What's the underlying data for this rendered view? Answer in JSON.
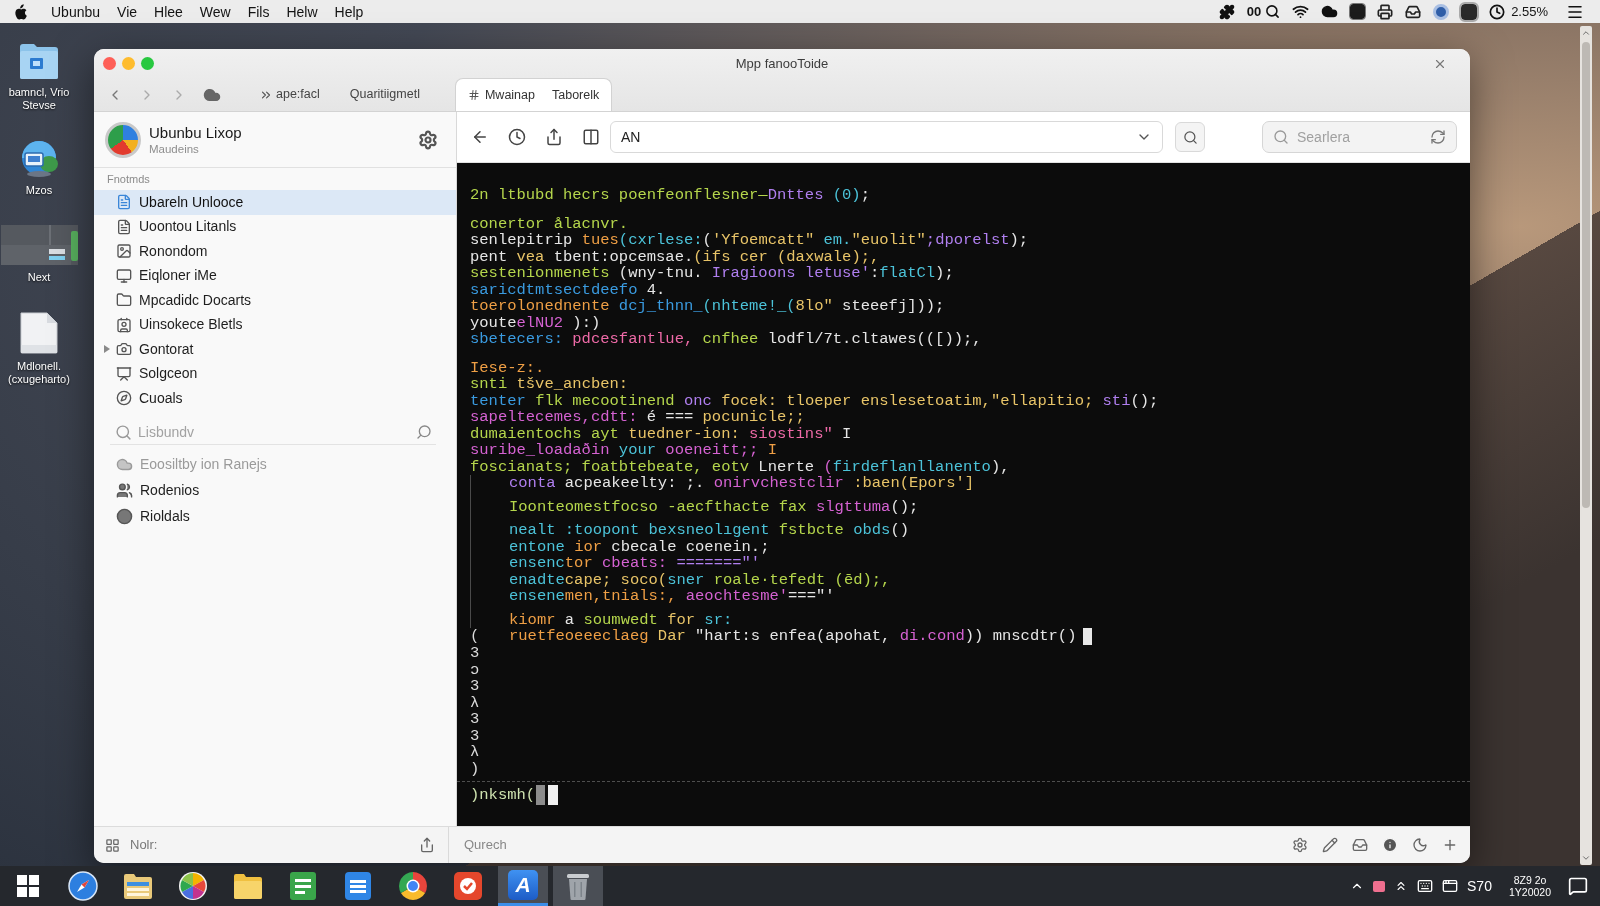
{
  "menu_bar": {
    "items": [
      "Ubunbu",
      "Vie",
      "Hlee",
      "Wew",
      "Fils",
      "Helw",
      "Help"
    ],
    "status_text": "00",
    "battery_text": "2.55%"
  },
  "desktop_icons": [
    {
      "label": "bamncl, Vrio Stevse"
    },
    {
      "label": "Mzos"
    },
    {
      "label": "Next"
    },
    {
      "label": "Mdlonell. (cxugeharto)"
    }
  ],
  "window": {
    "title": "Mpp fanooToide"
  },
  "tabs": [
    {
      "label": "ape:facl",
      "selected": false
    },
    {
      "label": "Quaritiigmetl",
      "selected": false
    },
    {
      "label": "Mwainap",
      "note": "Taborelk",
      "selected": true
    }
  ],
  "sidebar": {
    "profile": {
      "name": "Ubunbu Lixop",
      "subtitle": "Maudeins"
    },
    "section_label": "Fnotmds",
    "items": [
      {
        "label": "Ubareln Unlooce",
        "selected": true
      },
      {
        "label": "Uoontou Litanls",
        "selected": false
      },
      {
        "label": "Ronondom",
        "selected": false
      },
      {
        "label": "Eiqloner iMe",
        "selected": false
      },
      {
        "label": "Mpcadidc Docarts",
        "selected": false
      },
      {
        "label": "Uinsokece Bletls",
        "selected": false
      },
      {
        "label": "Gontorat",
        "selected": false,
        "expanded": false
      },
      {
        "label": "Solgceon",
        "selected": false
      },
      {
        "label": "Cuoals",
        "selected": false
      }
    ],
    "search": {
      "placeholder": "Lisbundv"
    },
    "extra_items": [
      {
        "label": "Eoosiltby ion Ranejs",
        "disabled": true
      },
      {
        "label": "Rodenios",
        "disabled": false
      },
      {
        "label": "Rioldals",
        "disabled": false
      }
    ]
  },
  "toolbar": {
    "address": "AN",
    "search": {
      "placeholder": "Searlera"
    }
  },
  "terminal": {
    "blocks": [
      {
        "lines": [
          {
            "cursor": false,
            "segments": [
              {
                "text": "2n ltbubd hecrs poenfeonflesner—",
                "color": "#b5d64c"
              },
              {
                "text": "Dnttes",
                "color": "#b07ff0"
              },
              {
                "text": " (0)",
                "color": "#4cc3d9"
              },
              {
                "text": ";",
                "color": "#e6e6e6"
              }
            ]
          }
        ]
      },
      {
        "lines": [
          {
            "cursor": false,
            "segments": [
              {
                "text": "conertor ålacnvr.",
                "color": "#b5d64c"
              }
            ]
          },
          {
            "cursor": false,
            "segments": [
              {
                "text": "senlepitrip ",
                "color": "#e6e6e6"
              },
              {
                "text": "tues",
                "color": "#ef9f45"
              },
              {
                "text": "(cxrlese:",
                "color": "#4cc3d9"
              },
              {
                "text": "(",
                "color": "#e6e6e6"
              },
              {
                "text": "'Yfoemcatt\"",
                "color": "#e8c468"
              },
              {
                "text": " em.",
                "color": "#4cc3d9"
              },
              {
                "text": "\"euolit\"",
                "color": "#e8c468"
              },
              {
                "text": ";dporelst",
                "color": "#b07ff0"
              },
              {
                "text": ");",
                "color": "#e6e6e6"
              }
            ]
          },
          {
            "cursor": false,
            "segments": [
              {
                "text": "pent ",
                "color": "#e6e6e6"
              },
              {
                "text": "vea ",
                "color": "#e8c468"
              },
              {
                "text": "tbent:opcemsae.",
                "color": "#e6e6e6"
              },
              {
                "text": "(ifs cer (daxwale);,",
                "color": "#e8c468"
              }
            ]
          },
          {
            "cursor": false,
            "segments": [
              {
                "text": "sestenionmenets ",
                "color": "#b5d64c"
              },
              {
                "text": "(wny-tnu. ",
                "color": "#e6e6e6"
              },
              {
                "text": "Iragioons letuse'",
                "color": "#b07ff0"
              },
              {
                "text": ":",
                "color": "#e6e6e6"
              },
              {
                "text": "flatCl",
                "color": "#4cc3d9"
              },
              {
                "text": ");",
                "color": "#e6e6e6"
              }
            ]
          },
          {
            "cursor": false,
            "segments": [
              {
                "text": "saricdtmtsectdeefo",
                "color": "#3a9be0"
              },
              {
                "text": " 4.",
                "color": "#e6e6e6"
              }
            ]
          },
          {
            "cursor": false,
            "segments": [
              {
                "text": "toerolonednente ",
                "color": "#ef9f45"
              },
              {
                "text": "dcj_thnn_",
                "color": "#3a9be0"
              },
              {
                "text": "(nhteme!_(",
                "color": "#4cc3d9"
              },
              {
                "text": "8lo\"",
                "color": "#e8c468"
              },
              {
                "text": " steeefj]));",
                "color": "#e6e6e6"
              }
            ]
          },
          {
            "cursor": false,
            "segments": [
              {
                "text": "youte",
                "color": "#e6e6e6"
              },
              {
                "text": "elNU2",
                "color": "#d562d2"
              },
              {
                "text": " ):)",
                "color": "#e6e6e6"
              }
            ]
          },
          {
            "cursor": false,
            "segments": [
              {
                "text": "sbetecers:",
                "color": "#3a9be0"
              },
              {
                "text": " pdcesfantlue,",
                "color": "#ee6aa7"
              },
              {
                "text": " cnfhee",
                "color": "#b5d64c"
              },
              {
                "text": " lodfl/7t.cltawes(([));,",
                "color": "#e6e6e6"
              }
            ]
          }
        ]
      },
      {
        "lines": [
          {
            "cursor": false,
            "segments": [
              {
                "text": "Iese-z:.",
                "color": "#ef9f45"
              }
            ]
          },
          {
            "cursor": false,
            "segments": [
              {
                "text": "snti ",
                "color": "#b5d64c"
              },
              {
                "text": "tšve_ancben:",
                "color": "#e8c468"
              }
            ]
          },
          {
            "cursor": false,
            "segments": [
              {
                "text": "tenter ",
                "color": "#3a9be0"
              },
              {
                "text": "flk mecootinend ",
                "color": "#b5d64c"
              },
              {
                "text": "onc ",
                "color": "#b07ff0"
              },
              {
                "text": "focek: tloeper enslesetoatim,\"ellapitio;",
                "color": "#e8c468"
              },
              {
                "text": " sti",
                "color": "#b07ff0"
              },
              {
                "text": "();",
                "color": "#e6e6e6"
              }
            ]
          },
          {
            "cursor": false,
            "segments": [
              {
                "text": "sapeltecemes,cdtt:",
                "color": "#d562d2"
              },
              {
                "text": " é === ",
                "color": "#e6e6e6"
              },
              {
                "text": "pocunicle;;",
                "color": "#e8c468"
              }
            ]
          },
          {
            "cursor": false,
            "segments": [
              {
                "text": "dumaientochs ayt ",
                "color": "#b5d64c"
              },
              {
                "text": "tuedner-ion: ",
                "color": "#e8c468"
              },
              {
                "text": "siostins\"",
                "color": "#ee6aa7"
              },
              {
                "text": " I",
                "color": "#e6e6e6"
              }
            ]
          },
          {
            "cursor": false,
            "segments": [
              {
                "text": "suribe_loadaðin ",
                "color": "#d562d2"
              },
              {
                "text": "your ",
                "color": "#4cc3d9"
              },
              {
                "text": "ooeneitt;;",
                "color": "#d562d2"
              },
              {
                "text": " I",
                "color": "#ef9f45"
              }
            ]
          },
          {
            "cursor": false,
            "segments": [
              {
                "text": "foscianats; foatbtebeate, eotv ",
                "color": "#b5d64c"
              },
              {
                "text": "Lnerte ",
                "color": "#e6e6e6"
              },
              {
                "text": "(",
                "color": "#d562d2"
              },
              {
                "text": "firdeflanllanento",
                "color": "#4cc3d9"
              },
              {
                "text": "),",
                "color": "#e6e6e6"
              }
            ]
          }
        ],
        "children": [
          {
            "lines": [
              {
                "cursor": false,
                "segments": [
                  {
                    "text": "conta ",
                    "color": "#b07ff0"
                  },
                  {
                    "text": "acpeakeelty: ;. ",
                    "color": "#e6e6e6"
                  },
                  {
                    "text": "onirvchestclir",
                    "color": "#d562d2"
                  },
                  {
                    "text": " :baen(Epors']",
                    "color": "#e8c468"
                  }
                ]
              }
            ]
          },
          {
            "lines": [
              {
                "cursor": false,
                "segments": [
                  {
                    "text": "Ioonteomestfocso -aecfthacte fax ",
                    "color": "#b5d64c"
                  },
                  {
                    "text": "slgttuma",
                    "color": "#d562d2"
                  },
                  {
                    "text": "();",
                    "color": "#e6e6e6"
                  }
                ]
              }
            ]
          },
          {
            "lines": [
              {
                "cursor": false,
                "segments": [
                  {
                    "text": "nealt :toopont bexsneolıgent ",
                    "color": "#4cc3d9"
                  },
                  {
                    "text": "fstbcte ",
                    "color": "#b5d64c"
                  },
                  {
                    "text": "obds",
                    "color": "#4cc3d9"
                  },
                  {
                    "text": "()",
                    "color": "#e6e6e6"
                  }
                ]
              },
              {
                "cursor": false,
                "segments": [
                  {
                    "text": "entone ",
                    "color": "#4cc3d9"
                  },
                  {
                    "text": "ior ",
                    "color": "#ef9f45"
                  },
                  {
                    "text": "cbecale coenein.;",
                    "color": "#e6e6e6"
                  }
                ]
              },
              {
                "cursor": false,
                "segments": [
                  {
                    "text": "ensenc",
                    "color": "#4cc3d9"
                  },
                  {
                    "text": "tor ",
                    "color": "#ef9f45"
                  },
                  {
                    "text": "cbeats: ",
                    "color": "#d562d2"
                  },
                  {
                    "text": "=======\"'",
                    "color": "#b07ff0"
                  }
                ]
              },
              {
                "cursor": false,
                "segments": [
                  {
                    "text": "enadte",
                    "color": "#4cc3d9"
                  },
                  {
                    "text": "cape; soco(",
                    "color": "#e8c468"
                  },
                  {
                    "text": "sner ",
                    "color": "#4cc3d9"
                  },
                  {
                    "text": "roale·tefedt (ēd);,",
                    "color": "#b5d64c"
                  }
                ]
              },
              {
                "cursor": false,
                "segments": [
                  {
                    "text": "ensene",
                    "color": "#4cc3d9"
                  },
                  {
                    "text": "men,tnials:, ",
                    "color": "#ef9f45"
                  },
                  {
                    "text": "aeochtesme'",
                    "color": "#d562d2"
                  },
                  {
                    "text": "===\"'",
                    "color": "#e6e6e6"
                  }
                ]
              }
            ]
          },
          {
            "lines": [
              {
                "cursor": false,
                "segments": [
                  {
                    "text": "kiomr ",
                    "color": "#ef9f45"
                  },
                  {
                    "text": "a ",
                    "color": "#e6e6e6"
                  },
                  {
                    "text": "soumwedt ",
                    "color": "#b5d64c"
                  },
                  {
                    "text": "for ",
                    "color": "#e8c468"
                  },
                  {
                    "text": "sr:",
                    "color": "#4cc3d9"
                  }
                ]
              },
              {
                "cursor": true,
                "gutter": "(",
                "segments": [
                  {
                    "text": "ruetfeoeeeclaeg ",
                    "color": "#ef9f45"
                  },
                  {
                    "text": "Dar ",
                    "color": "#e8c468"
                  },
                  {
                    "text": "\"hart:s enfea(apohat, ",
                    "color": "#e6e6e6"
                  },
                  {
                    "text": "di.cond",
                    "color": "#d562d2"
                  },
                  {
                    "text": ")) mnscdtr()",
                    "color": "#e6e6e6"
                  }
                ]
              }
            ]
          }
        ]
      }
    ],
    "gutter_lines": [
      "3",
      "ɔ",
      "3",
      "λ",
      "3",
      "3",
      "λ",
      ")"
    ],
    "prompt": {
      "text": ")nksmh(",
      "cursor": true
    }
  },
  "bottom_bar": {
    "left_label": "Nolr:",
    "right_label": "Qurech"
  },
  "taskbar": {
    "apps": [
      {
        "running": false,
        "selected": false
      },
      {
        "running": false,
        "selected": false
      },
      {
        "running": false,
        "selected": false
      },
      {
        "running": false,
        "selected": false
      },
      {
        "running": false,
        "selected": false
      },
      {
        "running": false,
        "selected": false
      },
      {
        "running": false,
        "selected": false
      },
      {
        "running": false,
        "selected": false
      },
      {
        "running": false,
        "selected": false
      },
      {
        "letter": "A",
        "running": true,
        "selected": true
      },
      {
        "running": true,
        "selected": false
      }
    ],
    "tray_text": "S70",
    "clock": {
      "time": "8Z9 2o",
      "date": "1Y20020"
    }
  }
}
